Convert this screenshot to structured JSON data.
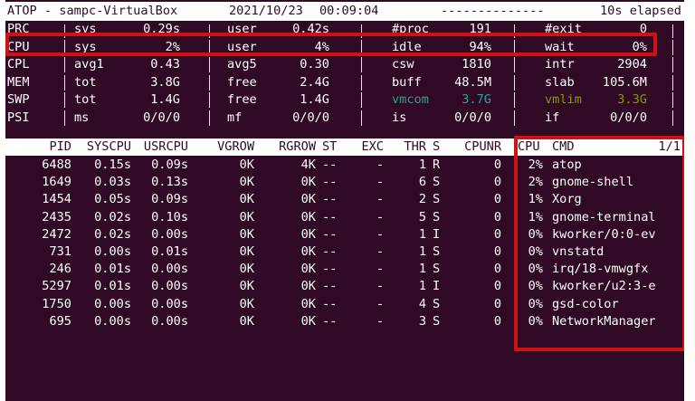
{
  "title_bar": {
    "app": "ATOP - sampc-VirtualBox",
    "date": "2021/10/23",
    "time": "00:09:04",
    "dashes": "--------------",
    "elapsed": "10s elapsed"
  },
  "sys_rows": [
    {
      "label": "PRC",
      "c1l": "sys",
      "c1v": "0.29s",
      "c2l": "user",
      "c2v": "0.42s",
      "c3l": "#proc",
      "c3v": "191",
      "c4l": "#exit",
      "c4v": "0"
    },
    {
      "label": "CPU",
      "c1l": "sys",
      "c1v": "2%",
      "c2l": "user",
      "c2v": "4%",
      "c3l": "idle",
      "c3v": "94%",
      "c4l": "wait",
      "c4v": "0%"
    },
    {
      "label": "CPL",
      "c1l": "avg1",
      "c1v": "0.43",
      "c2l": "avg5",
      "c2v": "0.30",
      "c3l": "csw",
      "c3v": "1810",
      "c4l": "intr",
      "c4v": "2904"
    },
    {
      "label": "MEM",
      "c1l": "tot",
      "c1v": "3.8G",
      "c2l": "free",
      "c2v": "2.4G",
      "c3l": "buff",
      "c3v": "48.5M",
      "c4l": "slab",
      "c4v": "105.6M"
    },
    {
      "label": "SWP",
      "c1l": "tot",
      "c1v": "1.4G",
      "c2l": "free",
      "c2v": "1.4G",
      "c3l": "vmcom",
      "c3v": "3.7G",
      "c4l": "vmlim",
      "c4v": "3.3G"
    },
    {
      "label": "PSI",
      "c1l": "ms",
      "c1v": "0/0/0",
      "c2l": "mf",
      "c2v": "0/0/0",
      "c3l": "is",
      "c3v": "0/0/0",
      "c4l": "if",
      "c4v": "0/0/0"
    }
  ],
  "colors": {
    "terminal_bg": "#300a24",
    "vmcom": "#2aa198",
    "vmlim": "#859900",
    "highlight": "#d01012"
  },
  "proc_header": {
    "pid": "PID",
    "syscpu": "SYSCPU",
    "usrcpu": "USRCPU",
    "vgrow": "VGROW",
    "rgrow": "RGROW",
    "st": "ST",
    "exc": "EXC",
    "thr": "THR",
    "s": "S",
    "cpunr": "CPUNR",
    "cpu": "CPU",
    "cmd": "CMD",
    "page": "1/1"
  },
  "processes": [
    {
      "pid": "6488",
      "syscpu": "0.15s",
      "usrcpu": "0.09s",
      "vgrow": "0K",
      "rgrow": "4K",
      "st": "--",
      "exc": "-",
      "thr": "1",
      "s": "R",
      "cpunr": "0",
      "cpu": "2%",
      "cmd": "atop"
    },
    {
      "pid": "1649",
      "syscpu": "0.03s",
      "usrcpu": "0.13s",
      "vgrow": "0K",
      "rgrow": "0K",
      "st": "--",
      "exc": "-",
      "thr": "6",
      "s": "S",
      "cpunr": "0",
      "cpu": "2%",
      "cmd": "gnome-shell"
    },
    {
      "pid": "1454",
      "syscpu": "0.05s",
      "usrcpu": "0.09s",
      "vgrow": "0K",
      "rgrow": "0K",
      "st": "--",
      "exc": "-",
      "thr": "2",
      "s": "S",
      "cpunr": "0",
      "cpu": "1%",
      "cmd": "Xorg"
    },
    {
      "pid": "2435",
      "syscpu": "0.02s",
      "usrcpu": "0.10s",
      "vgrow": "0K",
      "rgrow": "0K",
      "st": "--",
      "exc": "-",
      "thr": "5",
      "s": "S",
      "cpunr": "0",
      "cpu": "1%",
      "cmd": "gnome-terminal"
    },
    {
      "pid": "2472",
      "syscpu": "0.02s",
      "usrcpu": "0.00s",
      "vgrow": "0K",
      "rgrow": "0K",
      "st": "--",
      "exc": "-",
      "thr": "1",
      "s": "I",
      "cpunr": "0",
      "cpu": "0%",
      "cmd": "kworker/0:0-ev"
    },
    {
      "pid": "731",
      "syscpu": "0.00s",
      "usrcpu": "0.01s",
      "vgrow": "0K",
      "rgrow": "0K",
      "st": "--",
      "exc": "-",
      "thr": "1",
      "s": "S",
      "cpunr": "0",
      "cpu": "0%",
      "cmd": "vnstatd"
    },
    {
      "pid": "246",
      "syscpu": "0.01s",
      "usrcpu": "0.00s",
      "vgrow": "0K",
      "rgrow": "0K",
      "st": "--",
      "exc": "-",
      "thr": "1",
      "s": "S",
      "cpunr": "0",
      "cpu": "0%",
      "cmd": "irq/18-vmwgfx"
    },
    {
      "pid": "5297",
      "syscpu": "0.01s",
      "usrcpu": "0.00s",
      "vgrow": "0K",
      "rgrow": "0K",
      "st": "--",
      "exc": "-",
      "thr": "1",
      "s": "I",
      "cpunr": "0",
      "cpu": "0%",
      "cmd": "kworker/u2:3-e"
    },
    {
      "pid": "1750",
      "syscpu": "0.00s",
      "usrcpu": "0.00s",
      "vgrow": "0K",
      "rgrow": "0K",
      "st": "--",
      "exc": "-",
      "thr": "4",
      "s": "S",
      "cpunr": "0",
      "cpu": "0%",
      "cmd": "gsd-color"
    },
    {
      "pid": "695",
      "syscpu": "0.00s",
      "usrcpu": "0.00s",
      "vgrow": "0K",
      "rgrow": "0K",
      "st": "--",
      "exc": "-",
      "thr": "3",
      "s": "S",
      "cpunr": "0",
      "cpu": "0%",
      "cmd": "NetworkManager"
    }
  ]
}
